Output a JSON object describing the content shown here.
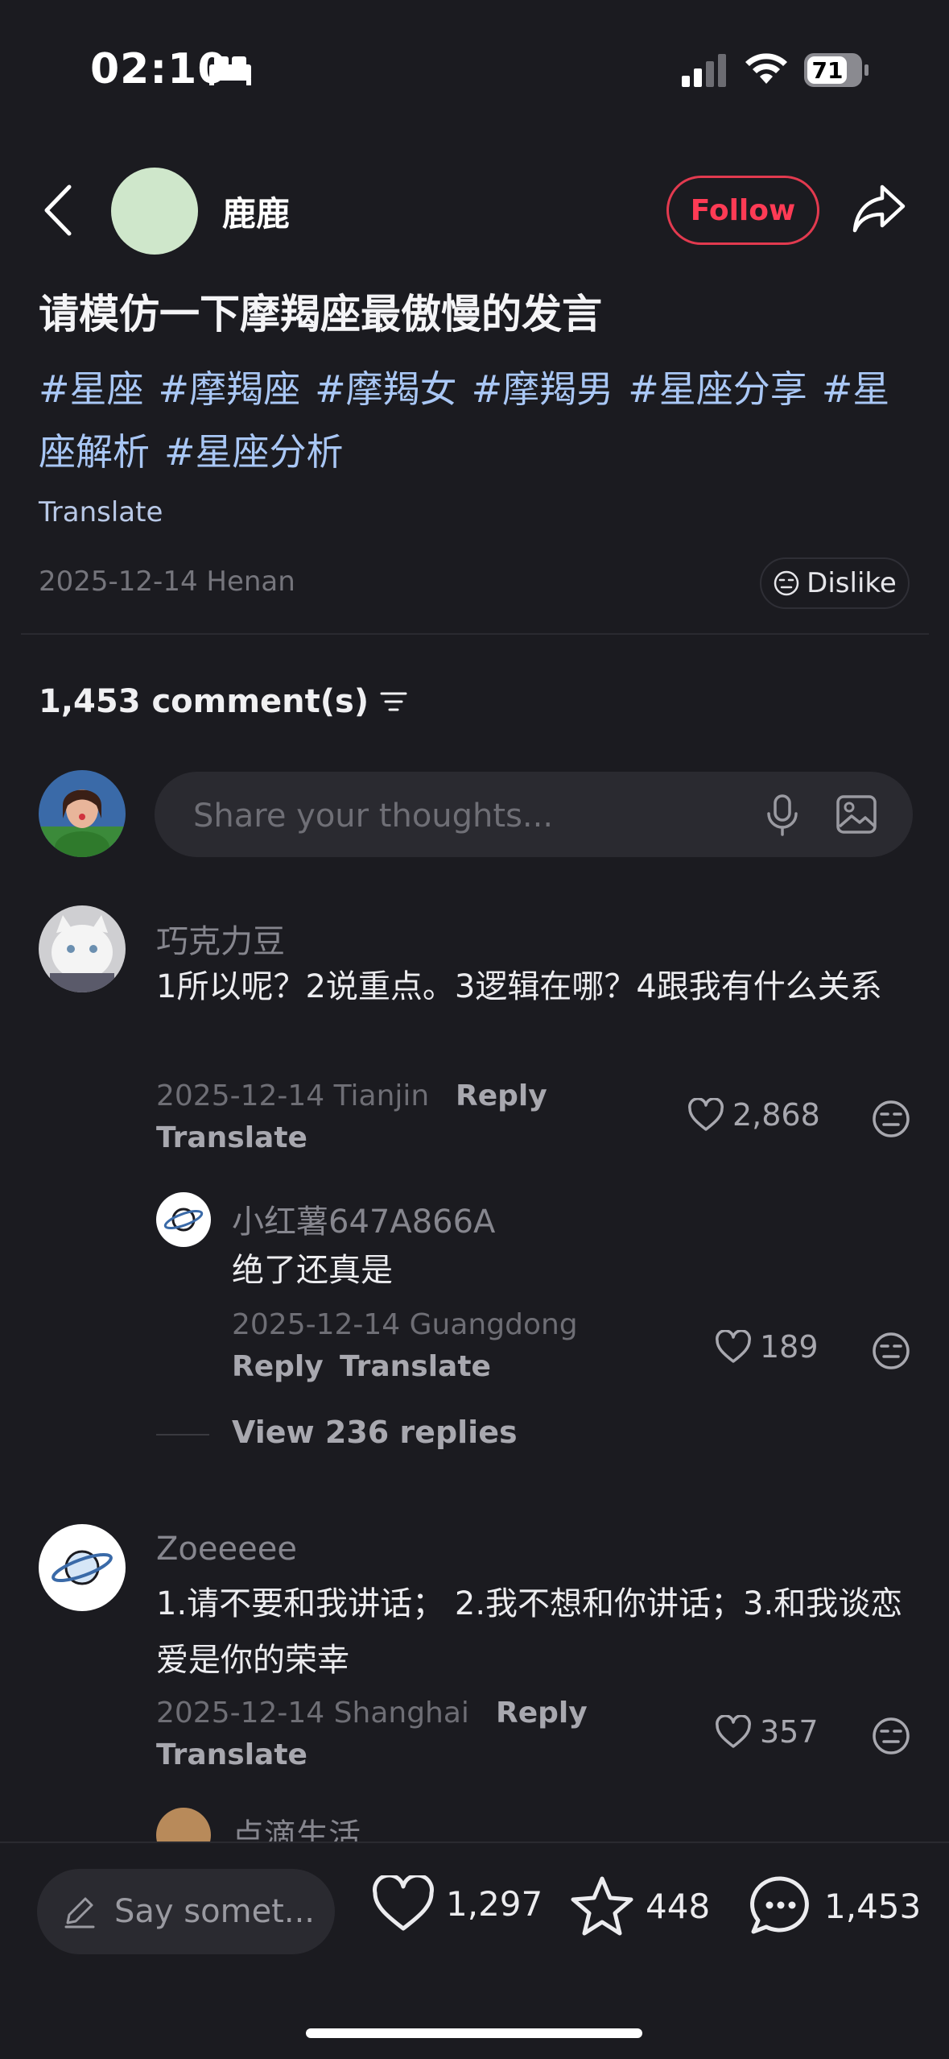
{
  "status": {
    "time": "02:10",
    "battery": "71"
  },
  "header": {
    "author": "鹿鹿",
    "follow_label": "Follow"
  },
  "post": {
    "title": "请模仿一下摩羯座最傲慢的发言",
    "tags": [
      "#星座",
      "#摩羯座",
      "#摩羯女",
      "#摩羯男",
      "#星座分享",
      "#星座解析",
      "#星座分析"
    ],
    "translate_label": "Translate",
    "meta": "2025-12-14 Henan",
    "dislike_label": "Dislike"
  },
  "comments_header": {
    "count": "1,453 comment(s)"
  },
  "comment_input": {
    "placeholder": "Share your thoughts..."
  },
  "comments": [
    {
      "name": "巧克力豆",
      "text": "1所以呢？2说重点。3逻辑在哪？4跟我有什么关系",
      "meta": "2025-12-14 Tianjin",
      "reply": "Reply",
      "translate": "Translate",
      "likes": "2,868"
    },
    {
      "name": "小红薯647A866A",
      "text": "绝了还真是",
      "meta": "2025-12-14 Guangdong",
      "reply": "Reply",
      "translate": "Translate",
      "likes": "189"
    },
    {
      "name": "Zoeeeee",
      "text": "1.请不要和我讲话； 2.我不想和你讲话；3.和我谈恋爱是你的荣幸",
      "meta": "2025-12-14 Shanghai",
      "reply": "Reply",
      "translate": "Translate",
      "likes": "357"
    },
    {
      "name": "点滴生活"
    }
  ],
  "view_replies": "View 236 replies",
  "bottom_bar": {
    "say_placeholder": "Say somet...",
    "likes": "1,297",
    "stars": "448",
    "comments": "1,453"
  },
  "colors": {
    "accent": "#ff3b55",
    "background": "#1b1b20",
    "tag": "#a9c7f5"
  }
}
